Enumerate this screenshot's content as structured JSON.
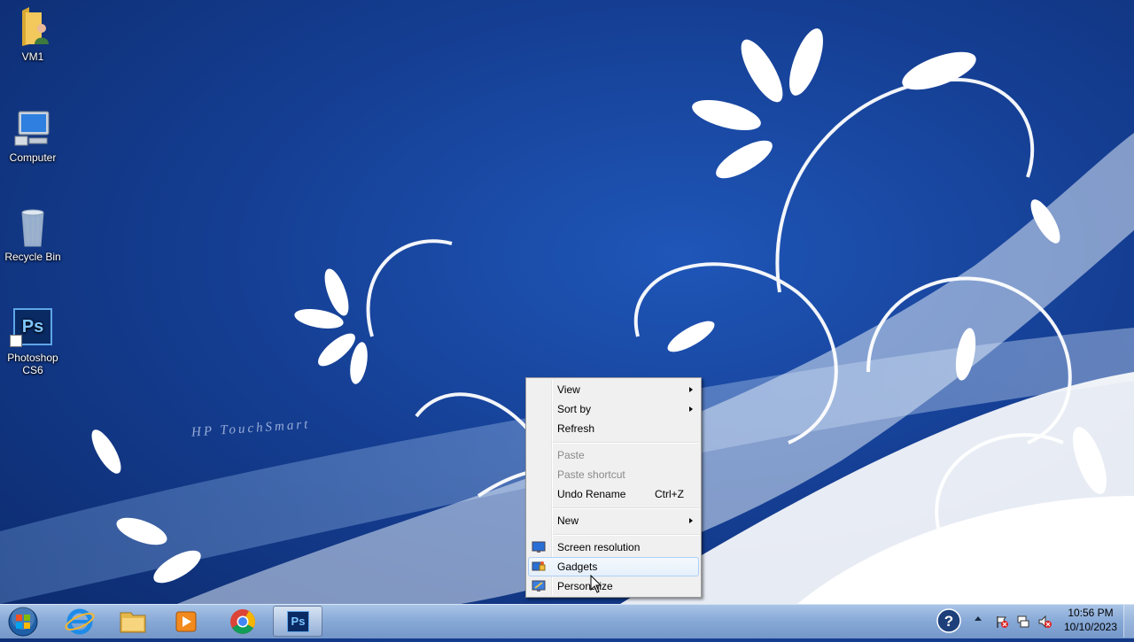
{
  "desktop": {
    "brand_text": "HP TouchSmart",
    "icons": [
      {
        "label": "VM1"
      },
      {
        "label": "Computer"
      },
      {
        "label": "Recycle Bin"
      },
      {
        "label_line1": "Photoshop",
        "label_line2": "CS6",
        "glyph_text": "Ps"
      }
    ]
  },
  "context_menu": {
    "items": {
      "view": "View",
      "sort_by": "Sort by",
      "refresh": "Refresh",
      "paste": "Paste",
      "paste_shortcut": "Paste shortcut",
      "undo_rename": "Undo Rename",
      "undo_rename_shortcut": "Ctrl+Z",
      "new": "New",
      "screen_resolution": "Screen resolution",
      "gadgets": "Gadgets",
      "personalize": "Personalize"
    }
  },
  "taskbar": {
    "photoshop_text": "Ps",
    "clock_time": "10:56 PM",
    "clock_date": "10/10/2023"
  },
  "colors": {
    "desktop_blue": "#153f94",
    "menu_bg": "#f0f0f0",
    "hover_border": "#aecff7",
    "photoshop_blue": "#0a2a63"
  }
}
